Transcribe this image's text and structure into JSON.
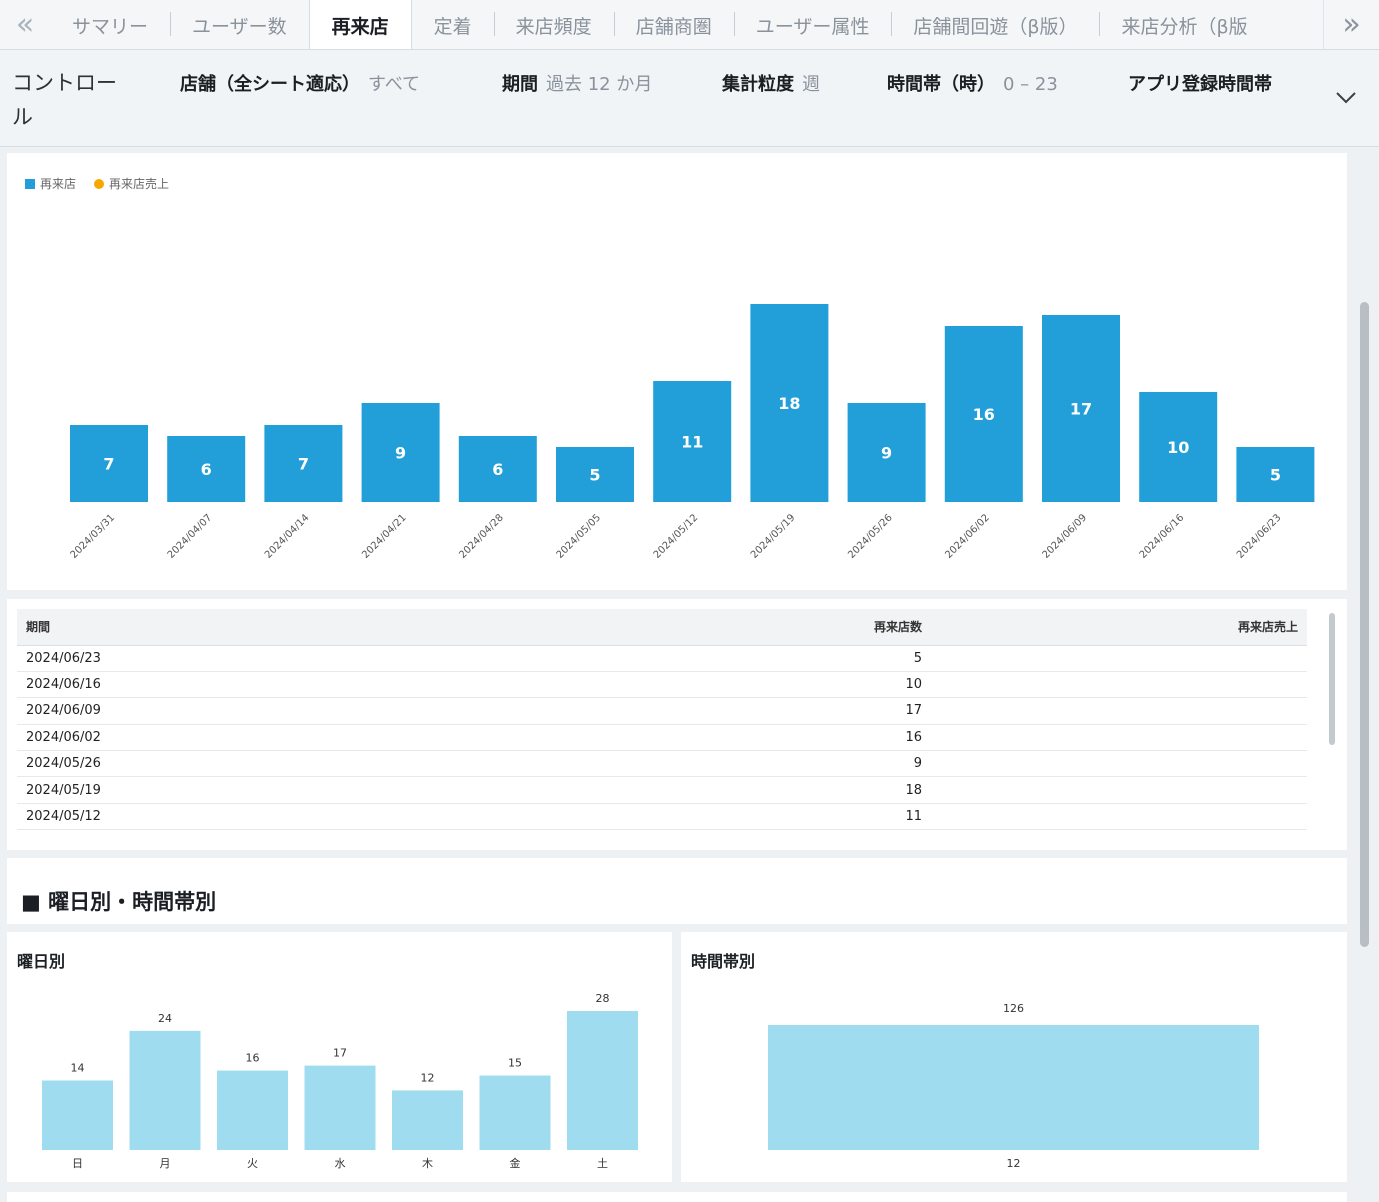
{
  "tabs": {
    "prev_label": "«",
    "next_label": "»",
    "items": [
      {
        "label": "サマリー",
        "active": false
      },
      {
        "label": "ユーザー数",
        "active": false
      },
      {
        "label": "再来店",
        "active": true
      },
      {
        "label": "定着",
        "active": false
      },
      {
        "label": "来店頻度",
        "active": false
      },
      {
        "label": "店舗商圏",
        "active": false
      },
      {
        "label": "ユーザー属性",
        "active": false
      },
      {
        "label": "店舗間回遊（β版）",
        "active": false
      },
      {
        "label": "来店分析（β版",
        "active": false
      }
    ]
  },
  "controls": {
    "title": "コントロール",
    "store_label": "店舗（全シート適応）",
    "store_value": "すべて",
    "period_label": "期間",
    "period_value": "過去 12 か月",
    "granularity_label": "集計粒度",
    "granularity_value": "週",
    "hour_label": "時間帯（時）",
    "hour_value": "0 – 23",
    "app_label": "アプリ登録時間帯"
  },
  "colors": {
    "main_bar": "#229fd8",
    "sales_legend": "#f6a800",
    "light_bar": "#9fdcef"
  },
  "chart_data": [
    {
      "type": "bar",
      "legend": [
        {
          "name": "再来店",
          "color": "#229fd8"
        },
        {
          "name": "再来店売上",
          "color": "#f6a800"
        }
      ],
      "categories": [
        "2024/03/31",
        "2024/04/07",
        "2024/04/14",
        "2024/04/21",
        "2024/04/28",
        "2024/05/05",
        "2024/05/12",
        "2024/05/19",
        "2024/05/26",
        "2024/06/02",
        "2024/06/09",
        "2024/06/16",
        "2024/06/23"
      ],
      "values": [
        7,
        6,
        7,
        9,
        6,
        5,
        11,
        18,
        9,
        16,
        17,
        10,
        5
      ],
      "ylim": [
        0,
        20
      ]
    },
    {
      "type": "bar",
      "title": "曜日別",
      "categories": [
        "日",
        "月",
        "火",
        "水",
        "木",
        "金",
        "土"
      ],
      "values": [
        14,
        24,
        16,
        17,
        12,
        15,
        28
      ],
      "ylim": [
        0,
        28
      ]
    },
    {
      "type": "bar",
      "title": "時間帯別",
      "categories": [
        "12"
      ],
      "values": [
        126
      ],
      "ylim": [
        0,
        126
      ]
    }
  ],
  "table": {
    "headers": [
      "期間",
      "再来店数",
      "再来店売上"
    ],
    "rows": [
      [
        "2024/06/23",
        "5",
        ""
      ],
      [
        "2024/06/16",
        "10",
        ""
      ],
      [
        "2024/06/09",
        "17",
        ""
      ],
      [
        "2024/06/02",
        "16",
        ""
      ],
      [
        "2024/05/26",
        "9",
        ""
      ],
      [
        "2024/05/19",
        "18",
        ""
      ],
      [
        "2024/05/12",
        "11",
        ""
      ]
    ]
  },
  "section": {
    "title": "■ 曜日別・時間帯別"
  }
}
